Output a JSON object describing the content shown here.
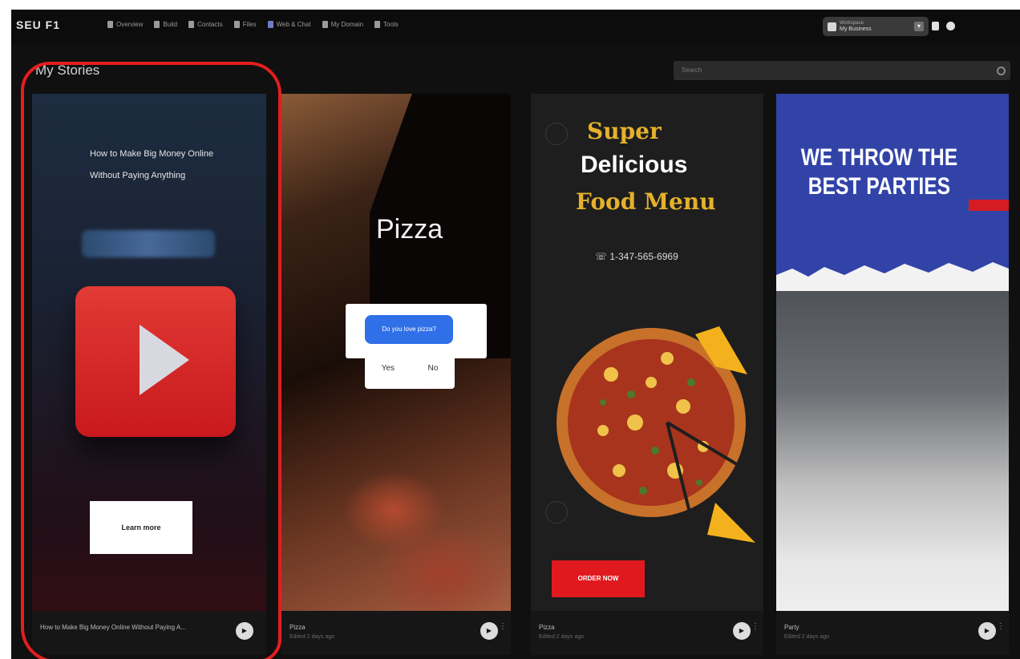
{
  "app": {
    "logo": "SEU F1",
    "nav": [
      {
        "label": "Overview",
        "icon": "home-icon"
      },
      {
        "label": "Build",
        "icon": "build-icon"
      },
      {
        "label": "Contacts",
        "icon": "contacts-icon"
      },
      {
        "label": "Files",
        "icon": "files-icon"
      },
      {
        "label": "Web & Chat",
        "icon": "chat-icon"
      },
      {
        "label": "My Domain",
        "icon": "domain-icon"
      },
      {
        "label": "Tools",
        "icon": "tools-icon"
      }
    ],
    "workspace": {
      "label": "Workspace",
      "name": "My Business"
    },
    "page_title": "My Stories",
    "search_placeholder": "Search"
  },
  "stories": [
    {
      "headline": "How to Make Big Money Online Without Paying Anything",
      "cta": "Learn more",
      "footer_name": "How to Make Big Money Online Without Paying A...",
      "footer_sub": ""
    },
    {
      "headline": "Pizza",
      "poll_question": "Do you love pizza?",
      "poll_options": [
        "Yes",
        "No"
      ],
      "footer_name": "Pizza",
      "footer_sub": "Edited 2 days ago"
    },
    {
      "headline_top": "Super",
      "headline_main": "Delicious",
      "headline_bottom": "Food Menu",
      "phone": "☏ 1-347-565-6969",
      "cta": "ORDER NOW",
      "footer_name": "Pizza",
      "footer_sub": "Edited 2 days ago"
    },
    {
      "headline": "WE THROW THE BEST PARTIES",
      "footer_name": "Party",
      "footer_sub": "Edited 2 days ago"
    }
  ],
  "icons": {
    "play": "▶",
    "more": "⋮",
    "chevron": "▾"
  },
  "colors": {
    "accent_red": "#e41e1e",
    "poll_blue": "#2f6fe8",
    "food_gold": "#e5b12c",
    "party_blue": "#3243a8"
  }
}
